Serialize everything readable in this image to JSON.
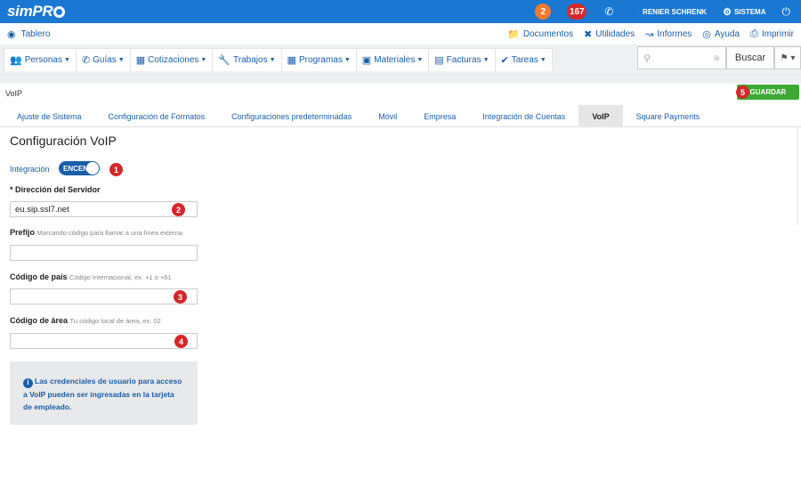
{
  "topbar": {
    "logo_text": "simPR",
    "badge_notifications": "2",
    "badge_alerts": "167",
    "user_name": "RENIER SCHRENK",
    "system_label": "SISTEMA"
  },
  "toolbar": {
    "dashboard_label": "Tablero",
    "links": [
      "Documentos",
      "Utilidades",
      "Informes",
      "Ayuda",
      "Imprimir"
    ]
  },
  "nav": {
    "items": [
      "Personas",
      "Guías",
      "Cotizaciones",
      "Trabajos",
      "Programas",
      "Materiales",
      "Facturas",
      "Tareas"
    ],
    "search_button": "Buscar"
  },
  "page": {
    "title": "VoIP",
    "save_button": "GUARDAR"
  },
  "tabs": [
    "Ajuste de Sistema",
    "Configuración de Formatos",
    "Configuraciones predeterminadas",
    "Móvil",
    "Empresa",
    "Integración de Cuentas",
    "VoIP",
    "Square Payments"
  ],
  "form": {
    "heading": "Configuración VoIP",
    "integration_label": "Integración",
    "integration_toggle": "ENCEN",
    "server_label": "* Dirección del Servidor",
    "server_value": "eu.sip.ssl7.net",
    "prefix_label": "Prefijo",
    "prefix_hint": "Marcando código para llamar a una línea externa",
    "prefix_value": "",
    "country_label": "Código de país",
    "country_hint": "Código Internacional, ex. +1 o +61",
    "country_value": "",
    "area_label": "Código de área",
    "area_hint": "Tu código local de área, ex. 02",
    "area_value": "",
    "info_text": "Las credenciales de usuario para acceso a VoIP pueden ser ingresadas en la tarjeta de empleado."
  },
  "markers": [
    "1",
    "2",
    "3",
    "4",
    "5"
  ],
  "colors": {
    "brand_blue": "#1a78d2",
    "link_blue": "#1a5ea8",
    "save_green": "#3aaa35",
    "marker_red": "#d3272b"
  }
}
